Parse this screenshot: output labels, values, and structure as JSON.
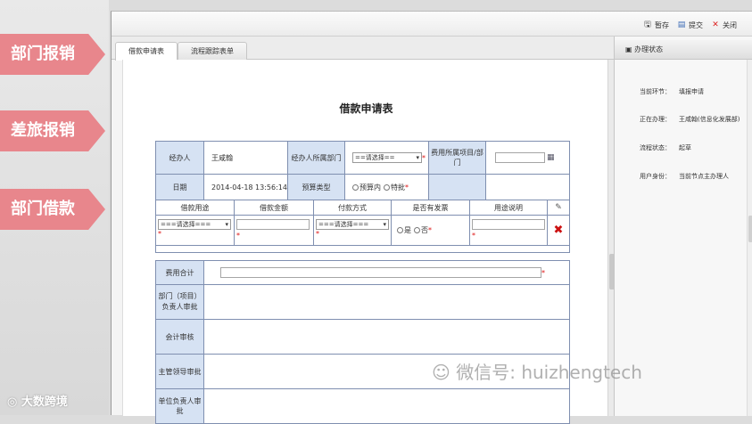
{
  "sidebar": {
    "labels": [
      "部门报销",
      "差旅报销",
      "部门借款"
    ],
    "bottom_logo": "大数跨境"
  },
  "toolbar": {
    "save_label": "暂存",
    "submit_label": "提交",
    "close_label": "关闭"
  },
  "tabs": [
    {
      "label": "借款申请表"
    },
    {
      "label": "流程跟踪表单"
    }
  ],
  "form": {
    "title": "借款申请表",
    "handler_label": "经办人",
    "handler_value": "王咸翰",
    "dept_label": "经办人所属部门",
    "dept_select": "==请选择==",
    "project_label": "费用所属项目/部门",
    "date_label": "日期",
    "date_value": "2014-04-18 13:56:14",
    "budget_type_label": "预算类型",
    "budget_in": "预算内",
    "budget_special": "特批",
    "columns": [
      "借款用途",
      "借款金额",
      "付款方式",
      "是否有发票",
      "用途说明"
    ],
    "purpose_select": "===请选择===",
    "pay_select": "===请选择===",
    "invoice_yes": "是",
    "invoice_no": "否",
    "total_label": "费用合计",
    "approvals": [
      "部门（项目）负责人审批",
      "会计审核",
      "主管领导审批",
      "单位负责人审批"
    ]
  },
  "status_panel": {
    "title": "办理状态",
    "rows": [
      {
        "key": "当前环节：",
        "value": "填报申请"
      },
      {
        "key": "正在办理：",
        "value": "王咸翰(信息化发展部)"
      },
      {
        "key": "流程状态：",
        "value": "起草"
      },
      {
        "key": "用户身份：",
        "value": "当前节点主办理人"
      }
    ]
  },
  "watermark": "微信号: huizhengtech",
  "colors": {
    "arrow": "#e8868c",
    "label_cell": "#d6e2f3",
    "border": "#7f8fb0",
    "required": "#d11111",
    "delete": "#cc1111"
  }
}
